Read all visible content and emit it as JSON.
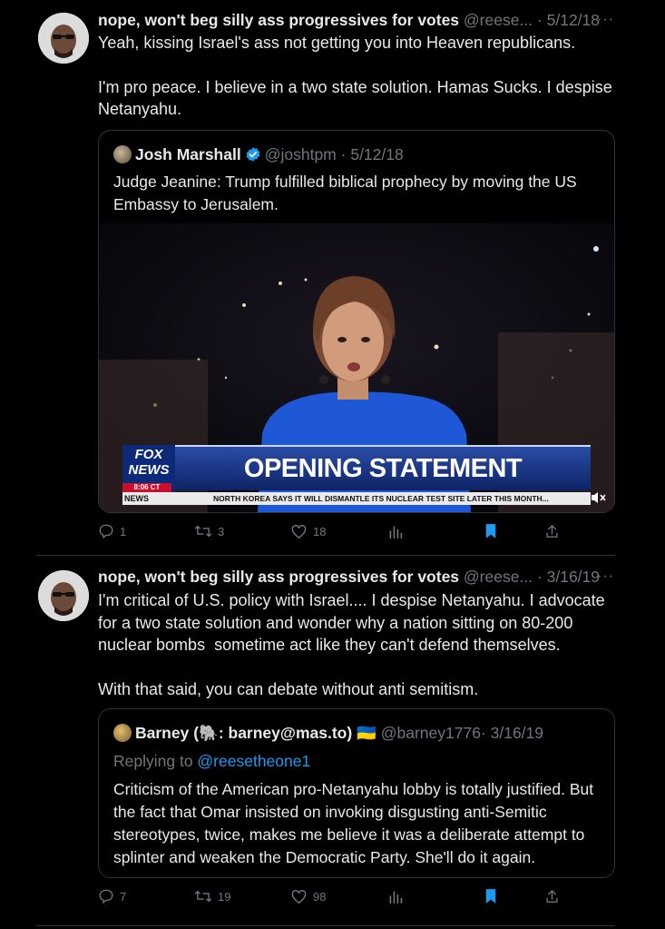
{
  "tweets": [
    {
      "author": {
        "name": "nope, won't beg silly ass progressives for votes",
        "handle": "@reese...",
        "date": "· 5/12/18"
      },
      "more_label": "···",
      "text_1": "Yeah, kissing Israel's ass not getting you into Heaven republicans.",
      "text_2": "I'm pro peace. I believe in a two state solution. Hamas Sucks. I despise Netanyahu.",
      "quote": {
        "name": "Josh Marshall",
        "handle": "@joshtpm",
        "date": "· 5/12/18",
        "text": "Judge Jeanine: Trump fulfilled biblical prophecy by moving the US Embassy to Jerusalem.",
        "media": {
          "logo_line1": "FOX",
          "logo_line2": "NEWS",
          "time": "8:06 CT",
          "banner": "OPENING STATEMENT",
          "ticker_label": "NEWS",
          "ticker": "NORTH KOREA SAYS IT WILL DISMANTLE ITS NUCLEAR TEST SITE LATER THIS MONTH..."
        }
      },
      "stats": {
        "replies": "1",
        "retweets": "3",
        "likes": "18"
      }
    },
    {
      "author": {
        "name": "nope, won't beg silly ass progressives for votes",
        "handle": "@reese...",
        "date": "· 3/16/19"
      },
      "more_label": "···",
      "text_1": "I'm critical of U.S. policy with Israel.... I despise Netanyahu. I advocate for a two state solution and wonder why a nation sitting on 80-200 nuclear bombs  sometime act like they can't defend themselves.",
      "text_2": "With that said, you can debate without anti semitism.",
      "quote": {
        "name": "Barney (🐘: barney@mas.to) 🇺🇦",
        "handle": "@barney1776",
        "date": "· 3/16/19",
        "replying_prefix": "Replying to ",
        "replying_to": "@reesetheone1",
        "text": "Criticism of the American pro-Netanyahu lobby is totally justified. But the fact that Omar insisted on invoking disgusting anti-Semitic stereotypes, twice, makes me believe it was a deliberate attempt to splinter and weaken the Democratic Party. She'll do it again."
      },
      "stats": {
        "replies": "7",
        "retweets": "19",
        "likes": "98"
      }
    }
  ],
  "colors": {
    "background": "#000000",
    "text": "#e7e9ea",
    "muted": "#71767b",
    "link": "#1d9bf0",
    "border": "#2f3336",
    "bookmark": "#1d9bf0"
  }
}
